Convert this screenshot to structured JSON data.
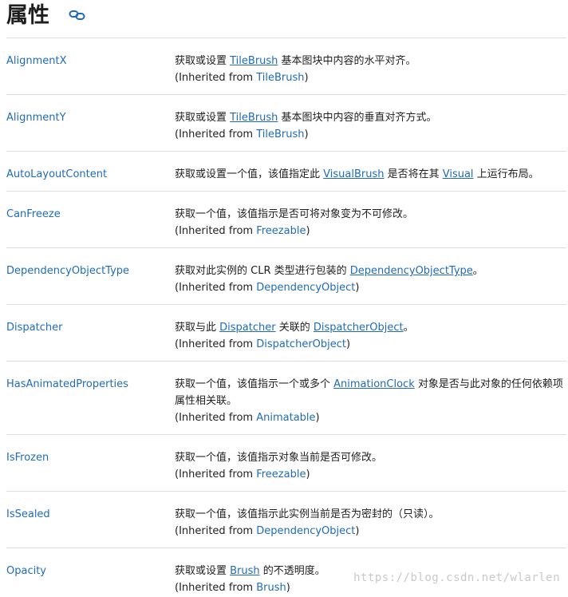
{
  "header": {
    "title": "属性"
  },
  "properties": [
    {
      "name": "AlignmentX",
      "desc": [
        "获取或设置 ",
        {
          "link": "TileBrush"
        },
        " 基本图块中内容的水平对齐。"
      ],
      "inherited": {
        "prefix": "(Inherited from ",
        "link": "TileBrush",
        "suffix": ")"
      }
    },
    {
      "name": "AlignmentY",
      "desc": [
        "获取或设置 ",
        {
          "link": "TileBrush"
        },
        " 基本图块中内容的垂直对齐方式。"
      ],
      "inherited": {
        "prefix": "(Inherited from ",
        "link": "TileBrush",
        "suffix": ")"
      }
    },
    {
      "name": "AutoLayoutContent",
      "desc": [
        "获取或设置一个值，该值指定此 ",
        {
          "link": "VisualBrush"
        },
        " 是否将在其 ",
        {
          "link": "Visual"
        },
        " 上运行布局。"
      ],
      "inherited": null
    },
    {
      "name": "CanFreeze",
      "desc": [
        "获取一个值，该值指示是否可将对象变为不可修改。"
      ],
      "inherited": {
        "prefix": "(Inherited from ",
        "link": "Freezable",
        "suffix": ")"
      }
    },
    {
      "name": "DependencyObjectType",
      "desc": [
        "获取对此实例的 CLR 类型进行包装的 ",
        {
          "link": "DependencyObjectType"
        },
        "。"
      ],
      "inherited": {
        "prefix": "(Inherited from ",
        "link": "DependencyObject",
        "suffix": ")"
      }
    },
    {
      "name": "Dispatcher",
      "desc": [
        "获取与此 ",
        {
          "link": "Dispatcher"
        },
        " 关联的 ",
        {
          "link": "DispatcherObject"
        },
        "。"
      ],
      "inherited": {
        "prefix": "(Inherited from ",
        "link": "DispatcherObject",
        "suffix": ")"
      }
    },
    {
      "name": "HasAnimatedProperties",
      "desc": [
        "获取一个值，该值指示一个或多个 ",
        {
          "link": "AnimationClock"
        },
        " 对象是否与此对象的任何依赖项属性相关联。"
      ],
      "inherited": {
        "prefix": "(Inherited from ",
        "link": "Animatable",
        "suffix": ")"
      }
    },
    {
      "name": "IsFrozen",
      "desc": [
        "获取一个值，该值指示对象当前是否可修改。"
      ],
      "inherited": {
        "prefix": "(Inherited from ",
        "link": "Freezable",
        "suffix": ")"
      }
    },
    {
      "name": "IsSealed",
      "desc": [
        "获取一个值，该值指示此实例当前是否为密封的（只读）。"
      ],
      "inherited": {
        "prefix": "(Inherited from ",
        "link": "DependencyObject",
        "suffix": ")"
      }
    },
    {
      "name": "Opacity",
      "desc": [
        "获取或设置 ",
        {
          "link": "Brush"
        },
        " 的不透明度。"
      ],
      "inherited": {
        "prefix": "(Inherited from ",
        "link": "Brush",
        "suffix": ")"
      }
    }
  ],
  "watermark": "https://blog.csdn.net/wlarlen",
  "colors": {
    "link": "#1f6bb8",
    "text": "#1e1e1e",
    "divider": "#dedede",
    "watermark": "#c8c8c8"
  },
  "icons": {
    "title_icon": "link-icon"
  }
}
